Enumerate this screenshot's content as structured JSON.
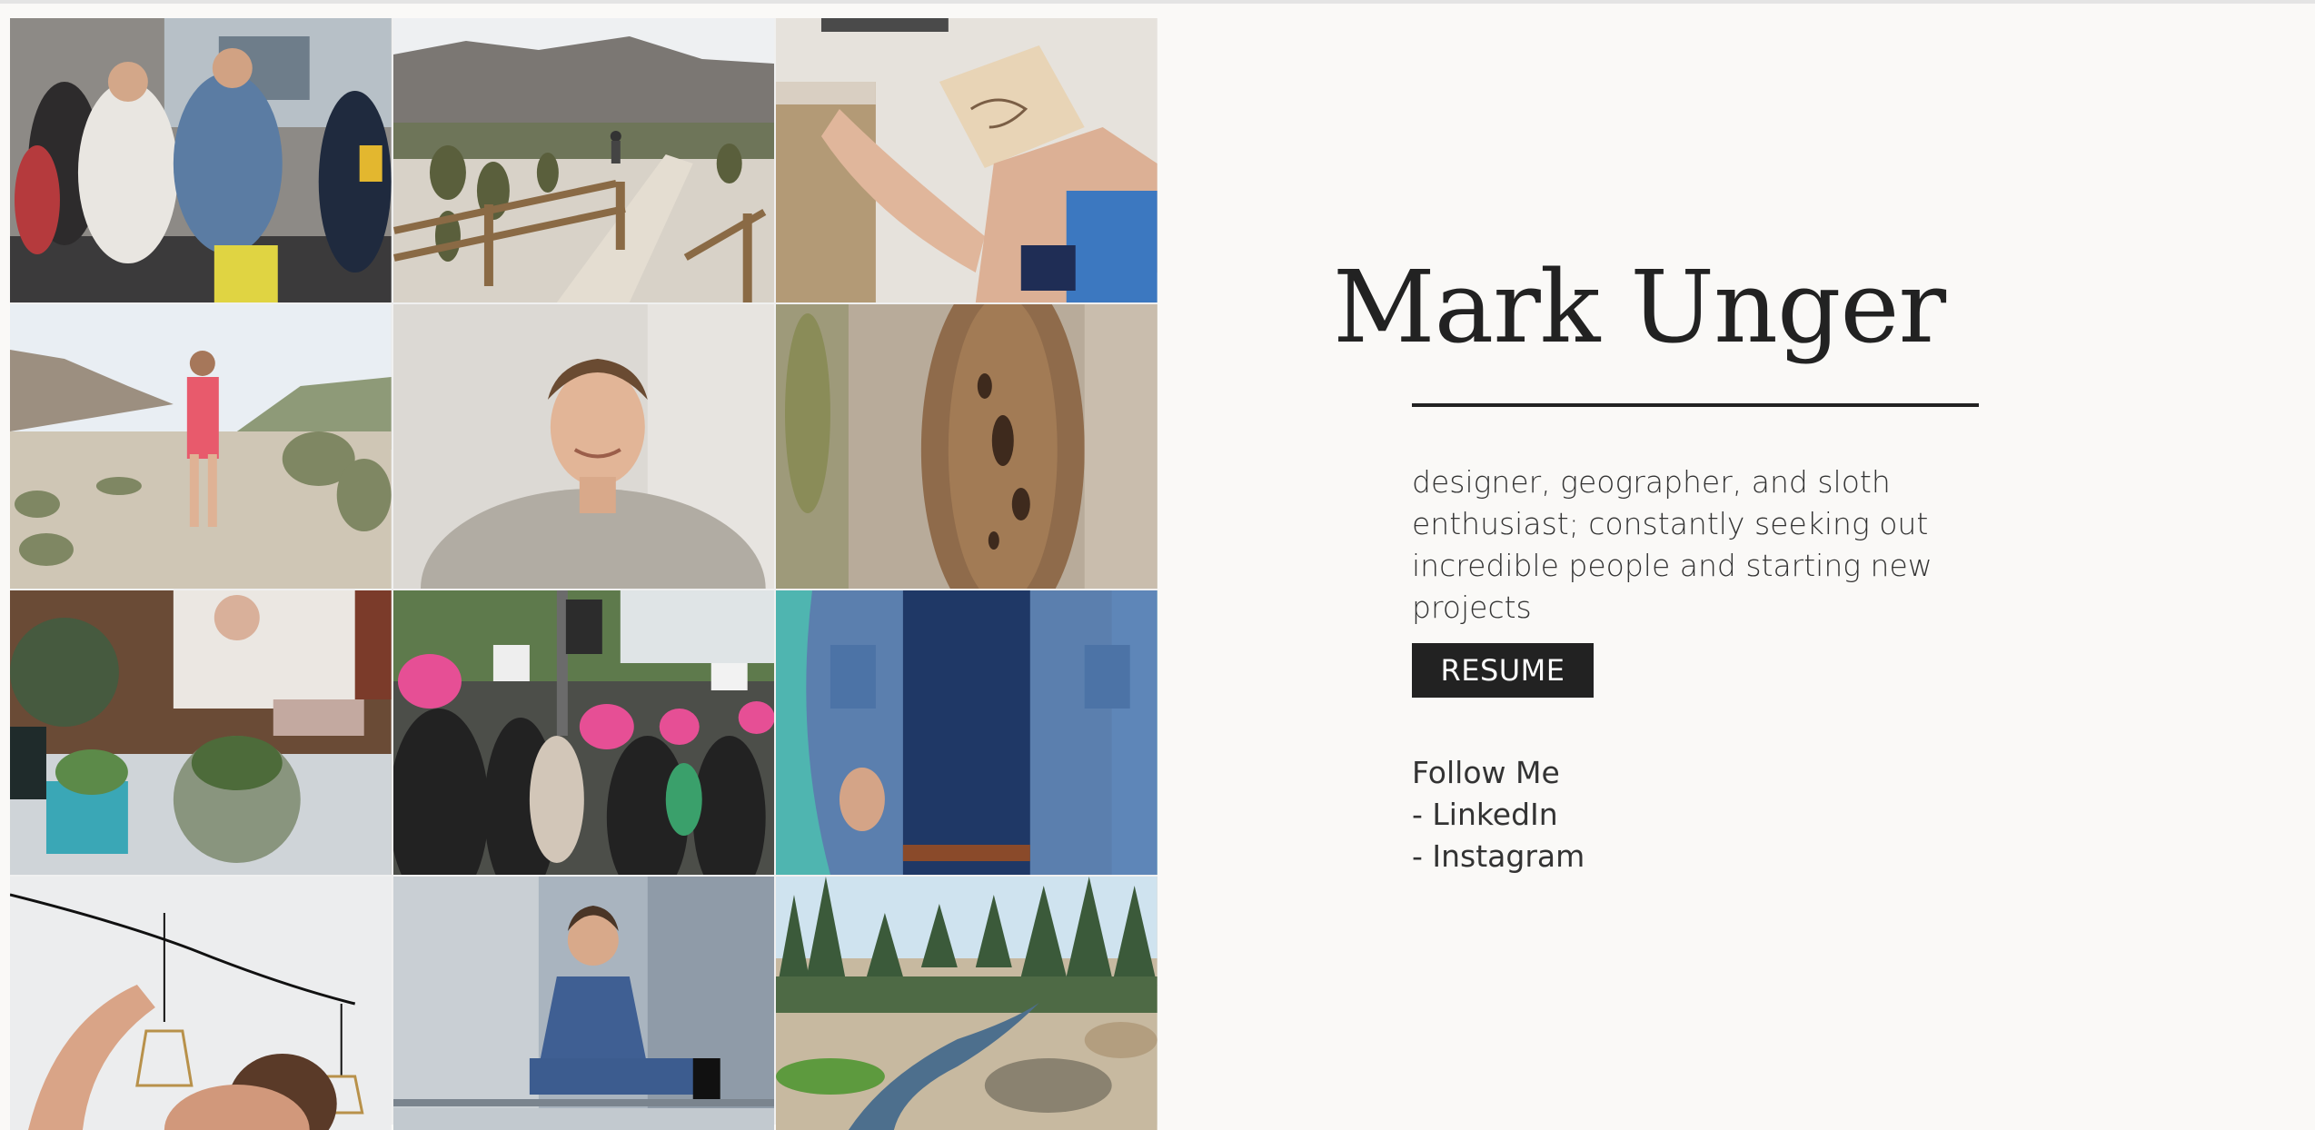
{
  "profile": {
    "name": "Mark Unger",
    "bio": "designer, geographer, and sloth enthusiast; constantly seeking out incredible people and starting new projects"
  },
  "actions": {
    "resume_label": "RESUME"
  },
  "social": {
    "heading": "Follow Me",
    "links": [
      "- LinkedIn",
      "- Instagram"
    ]
  },
  "gallery": {
    "photos": [
      {
        "subject": "crowd-party-photo"
      },
      {
        "subject": "desert-cactus-path-photo"
      },
      {
        "subject": "drawing-at-desk-photo"
      },
      {
        "subject": "desert-hiker-photo"
      },
      {
        "subject": "portrait-smiling-photo"
      },
      {
        "subject": "cactus-closeup-photo"
      },
      {
        "subject": "terrarium-making-photo"
      },
      {
        "subject": "protest-march-photo"
      },
      {
        "subject": "denim-jacket-photo"
      },
      {
        "subject": "pendant-lights-photo"
      },
      {
        "subject": "sitting-on-railing-photo"
      },
      {
        "subject": "forest-stream-photo"
      }
    ]
  },
  "colors": {
    "background": "#faf9f7",
    "text": "#222222",
    "button": "#222222",
    "button_text": "#ffffff"
  }
}
